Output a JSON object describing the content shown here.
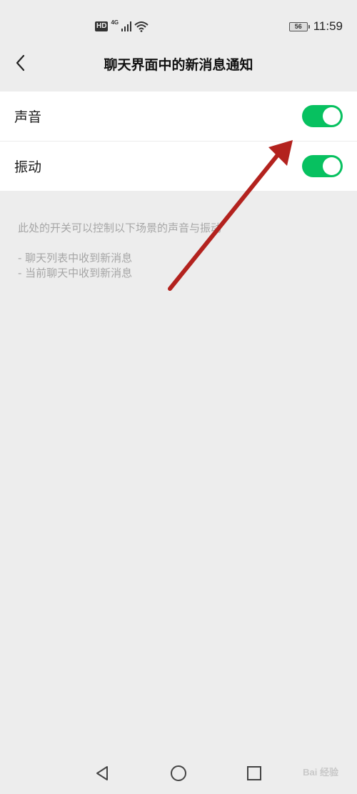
{
  "status_bar": {
    "hd": "HD",
    "network": "4G",
    "battery": "56",
    "time": "11:59"
  },
  "header": {
    "title": "聊天界面中的新消息通知",
    "back_icon": "chevron-left-icon"
  },
  "settings": [
    {
      "label": "声音",
      "enabled": true
    },
    {
      "label": "振动",
      "enabled": true
    }
  ],
  "note": {
    "description": "此处的开关可以控制以下场景的声音与振动",
    "items": [
      "- 聊天列表中收到新消息",
      "- 当前聊天中收到新消息"
    ]
  },
  "colors": {
    "toggle_on": "#07c160",
    "annotation_arrow": "#b3221e",
    "background": "#ededed"
  },
  "watermark": "Bai 经验"
}
